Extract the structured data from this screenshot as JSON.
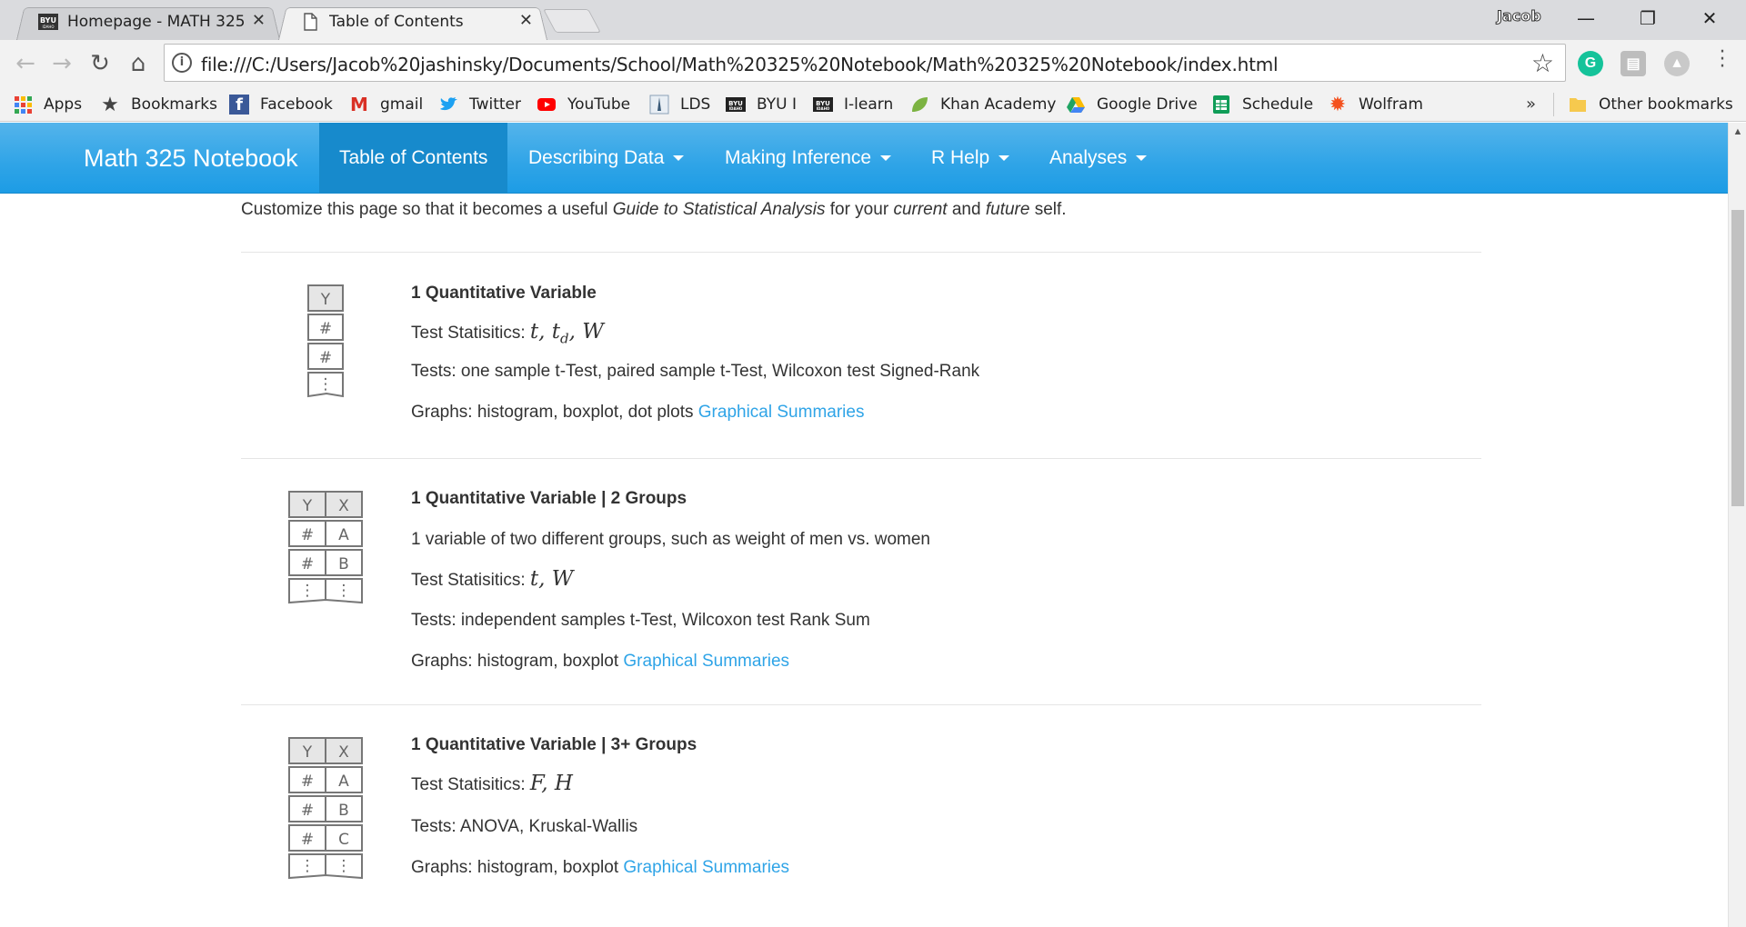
{
  "browser": {
    "tabs": [
      {
        "title": "Homepage - MATH 325:",
        "favicon": "byu-idaho-logo",
        "active": false
      },
      {
        "title": "Table of Contents",
        "favicon": "page-icon",
        "active": true
      }
    ],
    "profile_name": "Jacob",
    "url": "file:///C:/Users/Jacob%20jashinsky/Documents/School/Math%20325%20Notebook/Math%20325%20Notebook/index.html",
    "bookmarks": [
      {
        "label": "Apps",
        "icon": "apps-grid-icon",
        "color": "#e94235"
      },
      {
        "label": "Bookmarks",
        "icon": "star-icon",
        "color": "#444444"
      },
      {
        "label": "Facebook",
        "icon": "facebook-icon",
        "color": "#3b5998"
      },
      {
        "label": "gmail",
        "icon": "gmail-icon",
        "color": "#d93025"
      },
      {
        "label": "Twitter",
        "icon": "twitter-icon",
        "color": "#1da1f2"
      },
      {
        "label": "YouTube",
        "icon": "youtube-icon",
        "color": "#ff0000"
      },
      {
        "label": "LDS",
        "icon": "lds-icon",
        "color": "#3a5a78"
      },
      {
        "label": "BYU I",
        "icon": "byui-icon",
        "color": "#222222"
      },
      {
        "label": "I-learn",
        "icon": "byui-icon",
        "color": "#222222"
      },
      {
        "label": "Khan Academy",
        "icon": "leaf-icon",
        "color": "#7cb342"
      },
      {
        "label": "Google Drive",
        "icon": "drive-icon",
        "color": "#1fa463"
      },
      {
        "label": "Schedule",
        "icon": "sheets-icon",
        "color": "#0f9d58"
      },
      {
        "label": "Wolfram",
        "icon": "wolfram-icon",
        "color": "#f4511e"
      }
    ],
    "more_bookmarks": "»",
    "other_bookmarks": "Other bookmarks"
  },
  "site": {
    "brand": "Math 325 Notebook",
    "nav": [
      {
        "label": "Table of Contents",
        "active": true,
        "dropdown": false
      },
      {
        "label": "Describing Data",
        "active": false,
        "dropdown": true
      },
      {
        "label": "Making Inference",
        "active": false,
        "dropdown": true
      },
      {
        "label": "R Help",
        "active": false,
        "dropdown": true
      },
      {
        "label": "Analyses",
        "active": false,
        "dropdown": true
      }
    ],
    "accent_color": "#2fa4e7"
  },
  "intro": {
    "prefix": "Customize this page so that it becomes a useful ",
    "em1": "Guide to Statistical Analysis",
    "mid1": " for your ",
    "em2": "current",
    "mid2": " and ",
    "em3": "future",
    "suffix": " self."
  },
  "sections": [
    {
      "heading": "1 Quantitative Variable",
      "stats_label": "Test Statisitics: ",
      "stats": "t, t",
      "stats_sub": "d",
      "stats_tail": ", W",
      "tests": "Tests: one sample t-Test, paired sample t-Test, Wilcoxon test Signed-Rank",
      "graphs": "Graphs: histogram, boxplot, dot plots ",
      "link": "Graphical Summaries",
      "icon": {
        "headers": [
          "Y"
        ],
        "rows": [
          [
            "#"
          ],
          [
            "#"
          ]
        ]
      }
    },
    {
      "heading": "1 Quantitative Variable | 2 Groups",
      "description": "1 variable of two different groups, such as weight of men vs. women",
      "stats_label": "Test Statisitics: ",
      "stats": "t, W",
      "tests": "Tests: independent samples t-Test, Wilcoxon test Rank Sum",
      "graphs": "Graphs: histogram, boxplot ",
      "link": "Graphical Summaries",
      "icon": {
        "headers": [
          "Y",
          "X"
        ],
        "rows": [
          [
            "#",
            "A"
          ],
          [
            "#",
            "B"
          ]
        ]
      }
    },
    {
      "heading": "1 Quantitative Variable | 3+ Groups",
      "stats_label": "Test Statisitics: ",
      "stats": "F, H",
      "tests": "Tests: ANOVA, Kruskal-Wallis",
      "graphs": "Graphs: histogram, boxplot ",
      "link": "Graphical Summaries",
      "icon": {
        "headers": [
          "Y",
          "X"
        ],
        "rows": [
          [
            "#",
            "A"
          ],
          [
            "#",
            "B"
          ],
          [
            "#",
            "C"
          ]
        ]
      }
    }
  ]
}
